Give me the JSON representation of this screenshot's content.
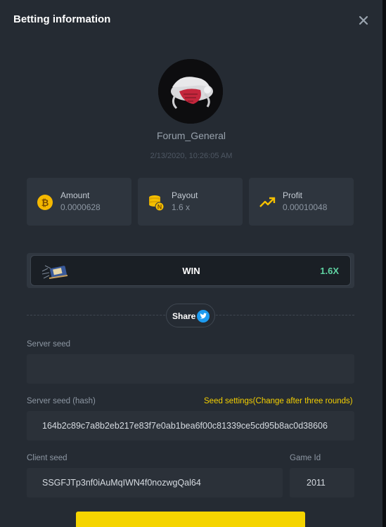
{
  "header": {
    "title": "Betting information",
    "close_icon": "close-icon"
  },
  "user": {
    "name": "Forum_General",
    "timestamp": "2/13/2020, 10:26:05 AM"
  },
  "stats": [
    {
      "label": "Amount",
      "value": "0.0000628",
      "icon": "bitcoin-coin-icon"
    },
    {
      "label": "Payout",
      "value": "1.6 x",
      "icon": "coin-stack-icon"
    },
    {
      "label": "Profit",
      "value": "0.00010048",
      "icon": "trend-up-icon"
    }
  ],
  "result": {
    "label": "WIN",
    "multiplier": "1.6X"
  },
  "share": {
    "label": "Share",
    "icon": "twitter-icon"
  },
  "fields": {
    "server_seed": {
      "label": "Server seed",
      "value": ""
    },
    "server_seed_hash": {
      "label": "Server seed (hash)",
      "value": "164b2c89c7a8b2eb217e83f7e0ab1bea6f00c81339ce5cd95b8ac0d38606"
    },
    "seed_settings_link": "Seed settings(Change after three rounds)",
    "client_seed": {
      "label": "Client seed",
      "value": "SSGFJTp3nf0iAuMqIWN4f0nozwgQal64"
    },
    "game_id": {
      "label": "Game Id",
      "value": "2011"
    }
  },
  "colors": {
    "accent_yellow": "#f5d000",
    "win_green": "#5fd3a2",
    "panel": "#2e353e",
    "background": "#252b33"
  }
}
